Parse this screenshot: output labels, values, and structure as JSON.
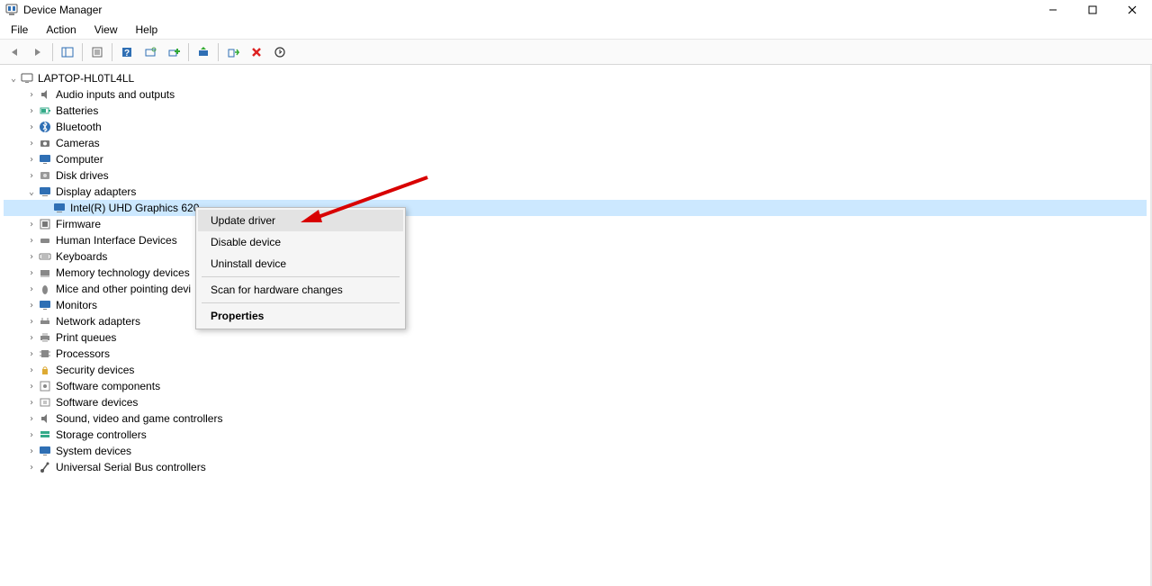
{
  "window": {
    "title": "Device Manager"
  },
  "menu": {
    "file": "File",
    "action": "Action",
    "view": "View",
    "help": "Help"
  },
  "tree": {
    "root": "LAPTOP-HL0TL4LL",
    "categories": {
      "audio": "Audio inputs and outputs",
      "batteries": "Batteries",
      "bluetooth": "Bluetooth",
      "cameras": "Cameras",
      "computer": "Computer",
      "disk": "Disk drives",
      "display": "Display adapters",
      "display_child": "Intel(R) UHD Graphics 620",
      "firmware": "Firmware",
      "hid": "Human Interface Devices",
      "keyboards": "Keyboards",
      "memtech": "Memory technology devices",
      "mice": "Mice and other pointing devi",
      "monitors": "Monitors",
      "network": "Network adapters",
      "printq": "Print queues",
      "processors": "Processors",
      "security": "Security devices",
      "softcomp": "Software components",
      "softdev": "Software devices",
      "svgc": "Sound, video and game controllers",
      "storage": "Storage controllers",
      "sysdev": "System devices",
      "usb": "Universal Serial Bus controllers"
    }
  },
  "context_menu": {
    "update": "Update driver",
    "disable": "Disable device",
    "uninstall": "Uninstall device",
    "scan": "Scan for hardware changes",
    "properties": "Properties"
  }
}
